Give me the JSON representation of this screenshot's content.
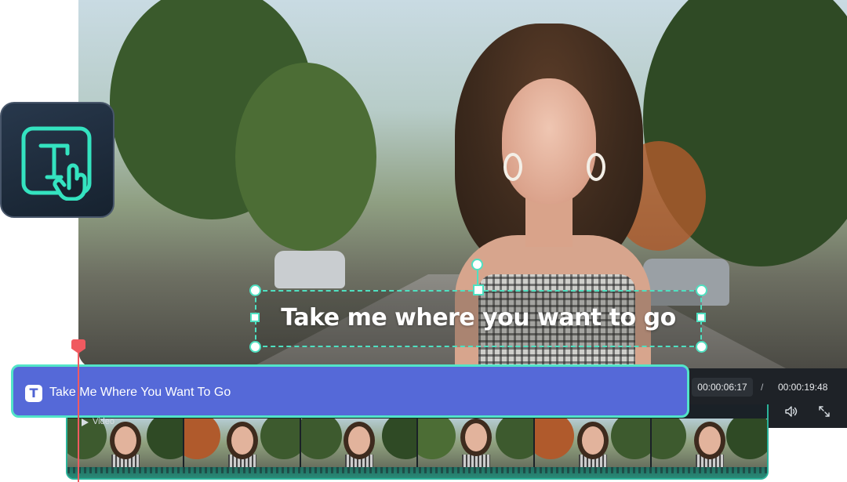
{
  "preview": {
    "overlay_text": "Take me where you want to go"
  },
  "timeline": {
    "text_clip_label": "Take Me Where You Want To Go",
    "text_clip_icon": "T",
    "video_track_label": "Video"
  },
  "timecode": {
    "current": "00:00:06:17",
    "separator": "/",
    "total": "00:00:19:48"
  },
  "icons": {
    "tool_badge": "text-tool-hand-icon",
    "volume": "volume-icon",
    "fullscreen": "fullscreen-icon",
    "video_track": "play-icon"
  },
  "colors": {
    "accent": "#4fe0c1",
    "text_clip": "#5569d8",
    "playhead": "#f05a60",
    "panel": "#1e2227"
  }
}
